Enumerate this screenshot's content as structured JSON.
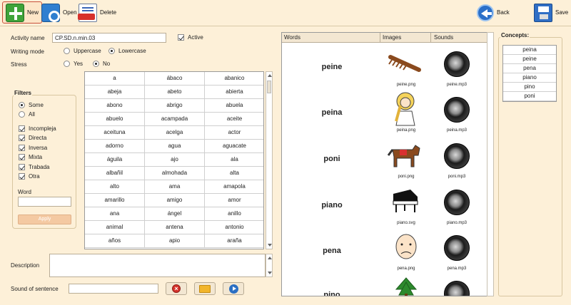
{
  "toolbar": {
    "new_label": "New",
    "open_label": "Open",
    "delete_label": "Delete",
    "back_label": "Back",
    "save_label": "Save"
  },
  "form": {
    "activity_name_label": "Activity name",
    "activity_name_value": "CP.SD.n.min.03",
    "active_label": "Active",
    "writing_mode_label": "Writing mode",
    "uppercase_label": "Uppercase",
    "lowercase_label": "Lowercase",
    "stress_label": "Stress",
    "stress_yes_label": "Yes",
    "stress_no_label": "No",
    "description_label": "Description",
    "sound_label": "Sound of sentence"
  },
  "filters": {
    "title": "Filters",
    "some_label": "Some",
    "all_label": "All",
    "options": [
      "Incompleja",
      "Directa",
      "Inversa",
      "Mixta",
      "Trabada",
      "Otra"
    ],
    "word_label": "Word",
    "apply_label": "Apply"
  },
  "word_grid": {
    "rows": [
      [
        "a",
        "ábaco",
        "abanico"
      ],
      [
        "abeja",
        "abeto",
        "abierta"
      ],
      [
        "abono",
        "abrigo",
        "abuela"
      ],
      [
        "abuelo",
        "acampada",
        "aceite"
      ],
      [
        "aceituna",
        "acelga",
        "actor"
      ],
      [
        "adorno",
        "agua",
        "aguacate"
      ],
      [
        "águila",
        "ajo",
        "ala"
      ],
      [
        "albañil",
        "almohada",
        "alta"
      ],
      [
        "alto",
        "ama",
        "amapola"
      ],
      [
        "amarillo",
        "amigo",
        "amor"
      ],
      [
        "ana",
        "ángel",
        "anillo"
      ],
      [
        "animal",
        "antena",
        "antonio"
      ],
      [
        "años",
        "apio",
        "araña"
      ]
    ]
  },
  "words_panel": {
    "col_words": "Words",
    "col_images": "Images",
    "col_sounds": "Sounds",
    "items": [
      {
        "word": "peine",
        "image": "peine.png",
        "sound": "peine.mp3"
      },
      {
        "word": "peina",
        "image": "peina.png",
        "sound": "peina.mp3"
      },
      {
        "word": "poni",
        "image": "poni.png",
        "sound": "poni.mp3"
      },
      {
        "word": "piano",
        "image": "piano.svg",
        "sound": "piano.mp3"
      },
      {
        "word": "pena",
        "image": "pena.png",
        "sound": "pena.mp3"
      },
      {
        "word": "pino",
        "image": "",
        "sound": ""
      }
    ]
  },
  "concepts": {
    "title": "Concepts:",
    "items": [
      "peina",
      "peine",
      "pena",
      "piano",
      "pino",
      "poni"
    ]
  }
}
